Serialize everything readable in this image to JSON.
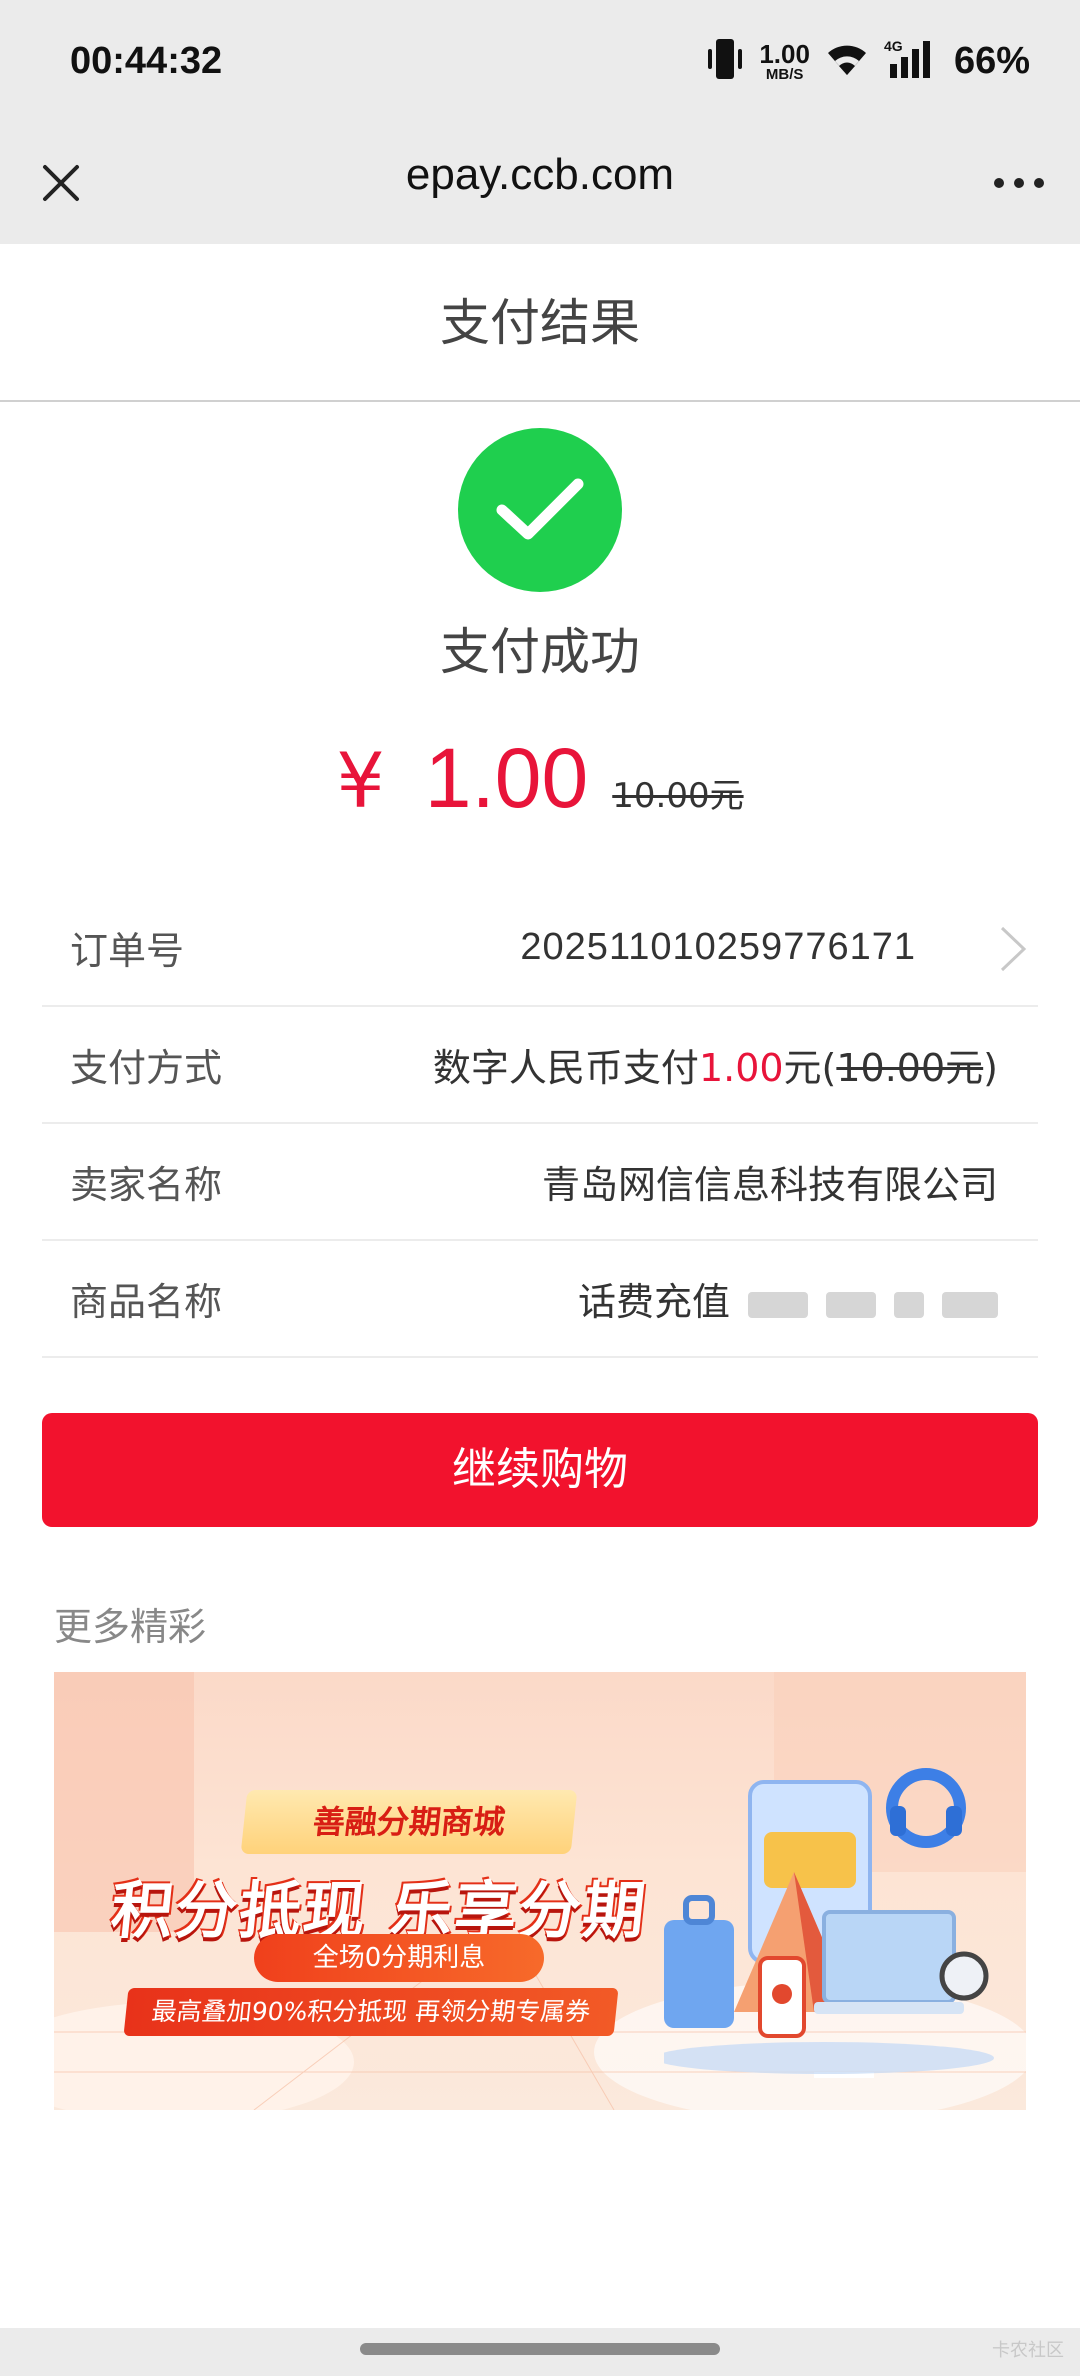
{
  "status_bar": {
    "time": "00:44:32",
    "net_speed_value": "1.00",
    "net_speed_unit": "MB/S",
    "network": "4G",
    "battery": "66%",
    "icons": [
      "vibrate-icon",
      "wifi-icon",
      "signal-icon"
    ]
  },
  "nav": {
    "url": "epay.ccb.com",
    "close_icon": "close-icon",
    "more_icon": "more-icon"
  },
  "header": {
    "title": "支付结果"
  },
  "result": {
    "icon": "check-circle-icon",
    "status_text": "支付成功",
    "currency_symbol": "¥",
    "amount": "1.00",
    "original_amount": "10.00元"
  },
  "details": {
    "order": {
      "label": "订单号",
      "value": "2025110102597761​71"
    },
    "payment": {
      "label": "支付方式",
      "prefix": "数字人民币支付",
      "amount": "1.00",
      "unit": "元(",
      "original": "10.00元",
      "suffix": ")"
    },
    "seller": {
      "label": "卖家名称",
      "value": "青岛网信信息科技有限公司"
    },
    "product": {
      "label": "商品名称",
      "value": "话费充值"
    }
  },
  "actions": {
    "continue_label": "继续购物"
  },
  "more": {
    "title": "更多精彩",
    "banner": {
      "tag": "善融分期商城",
      "headline": "积分抵现 乐享分期",
      "pill1": "全场0分期利息",
      "pill2": "最高叠加90%积分抵现 再领分期专属券"
    }
  },
  "colors": {
    "accent_red": "#e8143a",
    "button_red": "#f2122d",
    "success_green": "#1fcf4e"
  },
  "watermark": "卡农社区"
}
